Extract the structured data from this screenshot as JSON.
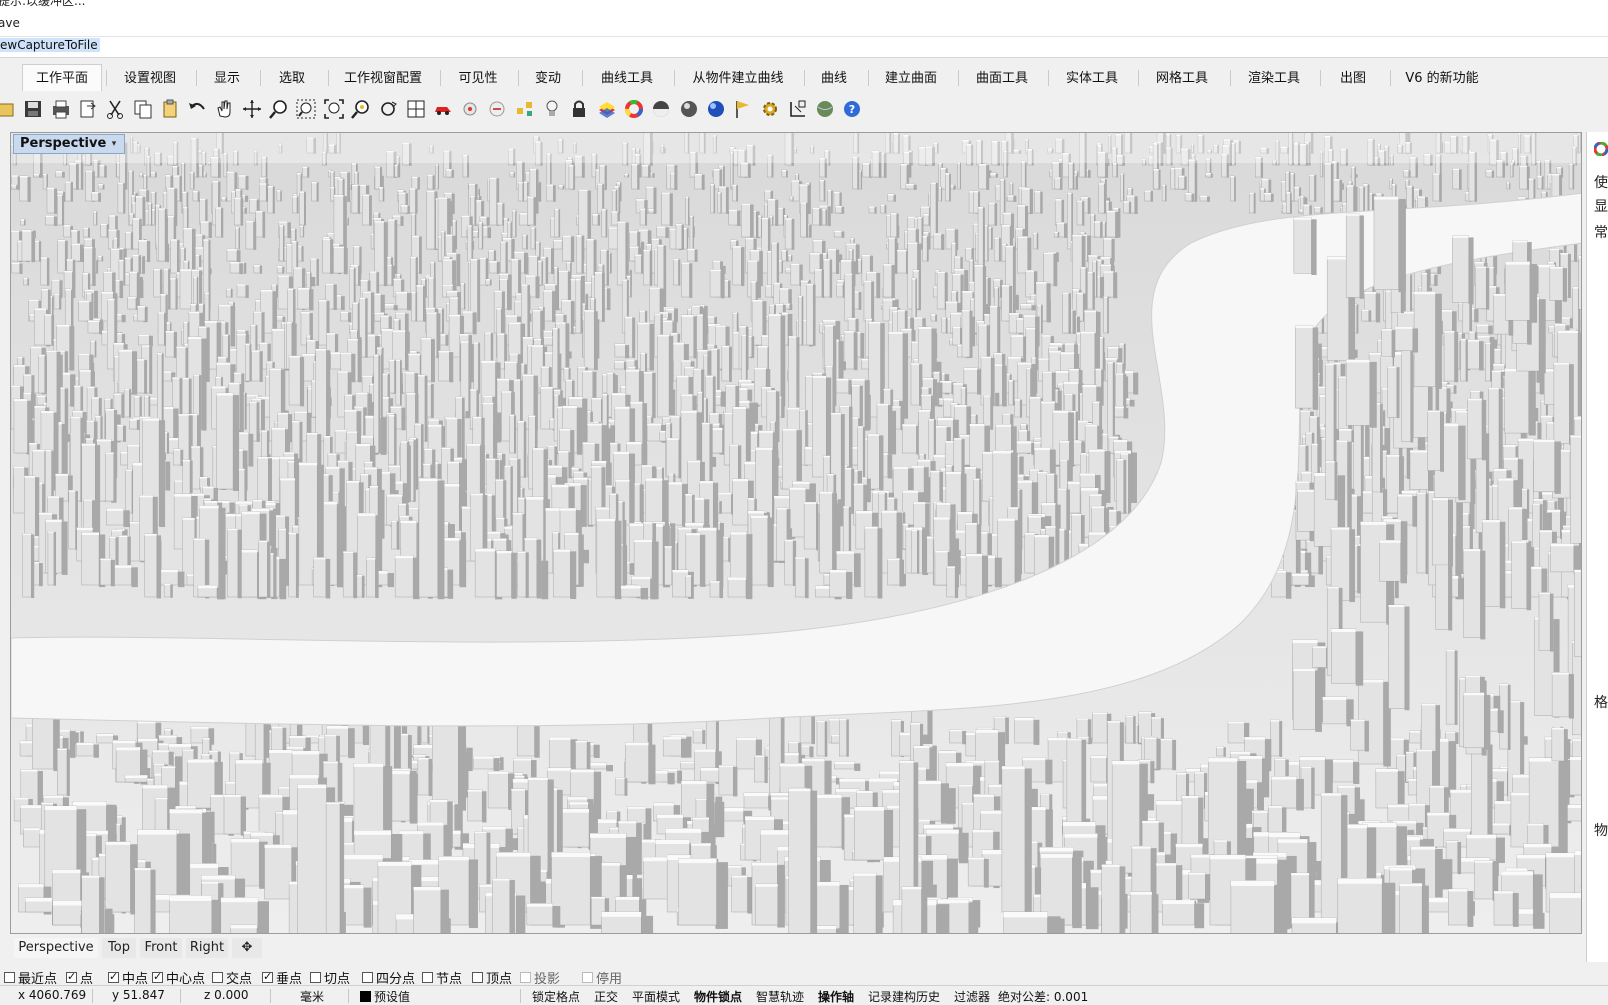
{
  "command": {
    "line1": "提示:以缓冲区...",
    "line2": "ave",
    "current": "ewCaptureToFile"
  },
  "tabs": [
    {
      "label": "工作平面",
      "active": true
    },
    {
      "label": "设置视图"
    },
    {
      "label": "显示"
    },
    {
      "label": "选取"
    },
    {
      "label": "工作视窗配置"
    },
    {
      "label": "可见性"
    },
    {
      "label": "变动"
    },
    {
      "label": "曲线工具"
    },
    {
      "label": "从物件建立曲线"
    },
    {
      "label": "曲线"
    },
    {
      "label": "建立曲面"
    },
    {
      "label": "曲面工具"
    },
    {
      "label": "实体工具"
    },
    {
      "label": "网格工具"
    },
    {
      "label": "渲染工具"
    },
    {
      "label": "出图"
    },
    {
      "label": "V6 的新功能"
    }
  ],
  "toolbar_icons": [
    "open-icon",
    "save-icon",
    "print-icon",
    "import-icon",
    "cut-icon",
    "copy-icon",
    "paste-icon",
    "undo-icon",
    "pan-hand-icon",
    "rotate-view-icon",
    "zoom-icon",
    "zoom-window-icon",
    "zoom-extents-icon",
    "zoom-selected-icon",
    "rotate-camera-icon",
    "four-viewports-icon",
    "car-icon",
    "plugin-icon",
    "hide-icon",
    "points-icon",
    "light-icon",
    "lock-icon",
    "layer-icon",
    "color-wheel-icon",
    "sphere-shaded-icon",
    "sphere-rendered-icon",
    "sphere-blue-icon",
    "flag-icon",
    "gear-icon",
    "dimension-icon",
    "globe-icon",
    "help-icon"
  ],
  "viewport": {
    "title": "Perspective",
    "dropdown": "▾"
  },
  "right_panel": {
    "chars": [
      "使",
      "显",
      "常",
      "格",
      "物"
    ]
  },
  "view_tabs": [
    {
      "label": "Perspective",
      "active": true
    },
    {
      "label": "Top"
    },
    {
      "label": "Front"
    },
    {
      "label": "Right"
    },
    {
      "label": "✥"
    }
  ],
  "osnaps": [
    {
      "label": "最近点",
      "checked": false
    },
    {
      "label": "点",
      "checked": true
    },
    {
      "label": "中点",
      "checked": true
    },
    {
      "label": "中心点",
      "checked": true
    },
    {
      "label": "交点",
      "checked": false
    },
    {
      "label": "垂点",
      "checked": true
    },
    {
      "label": "切点",
      "checked": false
    },
    {
      "label": "四分点",
      "checked": false
    },
    {
      "label": "节点",
      "checked": false
    },
    {
      "label": "顶点",
      "checked": false
    },
    {
      "label": "投影",
      "checked": false,
      "dim": true
    },
    {
      "label": "停用",
      "checked": false,
      "dim": true
    }
  ],
  "status": {
    "x": "x 4060.769",
    "y": "y 51.847",
    "z": "z 0.000",
    "units": "毫米",
    "layer": "预设值",
    "grid_snap": "锁定格点",
    "ortho": "正交",
    "planar": "平面模式",
    "osnap": "物件锁点",
    "smarttrack": "智慧轨迹",
    "gumball": "操作轴",
    "history": "记录建构历史",
    "filter": "过滤器",
    "tolerance": "绝对公差: 0.001"
  }
}
